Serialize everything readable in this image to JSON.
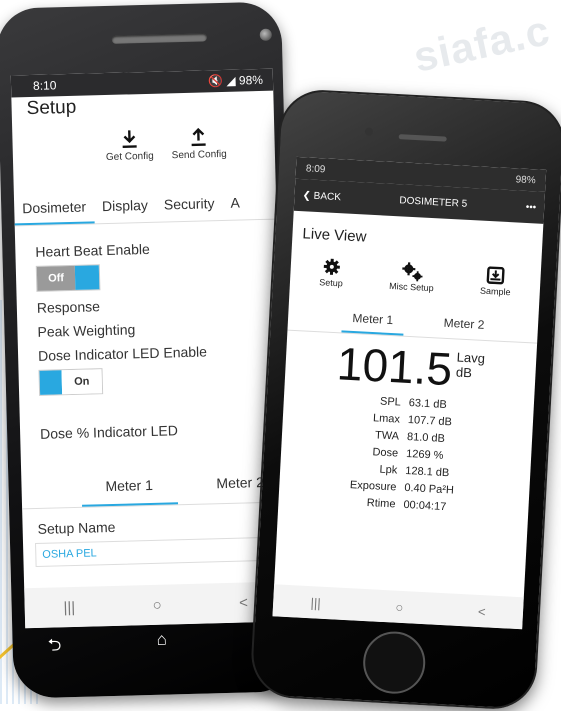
{
  "watermark": "siafa.c",
  "android": {
    "status": {
      "time": "8:10",
      "icons": "🔇 ◢ 98%"
    },
    "title": "Setup",
    "actions": [
      {
        "icon": "download-icon",
        "label": "Get Config"
      },
      {
        "icon": "upload-icon",
        "label": "Send Config"
      }
    ],
    "tabs": [
      "Dosimeter",
      "Display",
      "Security",
      "A"
    ],
    "heart_beat_label": "Heart Beat Enable",
    "heart_beat_toggle": "Off",
    "response_label": "Response",
    "peak_weighting_label": "Peak Weighting",
    "dose_led_label": "Dose Indicator LED Enable",
    "dose_led_toggle": "On",
    "dose_pct_label": "Dose % Indicator LED",
    "meter_tabs": [
      "Meter 1",
      "Meter 2"
    ],
    "setup_name_label": "Setup Name",
    "setup_name_value": "OSHA PEL",
    "navbar": {
      "recents": "|||",
      "home": "○",
      "back": "<"
    },
    "hw_buttons": {
      "back": "⮌",
      "home": "⌂",
      "recents": "❐"
    }
  },
  "iphone": {
    "status": {
      "time": "8:09",
      "icons": "98%"
    },
    "nav": {
      "back_label": "BACK",
      "title": "DOSIMETER 5",
      "more": "•••"
    },
    "title": "Live View",
    "actions": [
      {
        "icon": "gear-icon",
        "label": "Setup"
      },
      {
        "icon": "gears-icon",
        "label": "Misc Setup"
      },
      {
        "icon": "sample-icon",
        "label": "Sample"
      }
    ],
    "meter_tabs": [
      "Meter 1",
      "Meter 2"
    ],
    "reading": {
      "value": "101.5",
      "unit_top": "Lavg",
      "unit_bottom": "dB"
    },
    "stats": [
      {
        "k": "SPL",
        "v": "63.1 dB"
      },
      {
        "k": "Lmax",
        "v": "107.7 dB"
      },
      {
        "k": "TWA",
        "v": "81.0 dB"
      },
      {
        "k": "Dose",
        "v": "1269 %"
      },
      {
        "k": "Lpk",
        "v": "128.1 dB"
      },
      {
        "k": "Exposure",
        "v": "0.40 Pa²H"
      },
      {
        "k": "Rtime",
        "v": "00:04:17"
      }
    ],
    "navbar": {
      "recents": "|||",
      "home": "○",
      "back": "<"
    }
  },
  "colors": {
    "accent": "#29a8e0",
    "toggle_off": "#9a9a9a"
  }
}
